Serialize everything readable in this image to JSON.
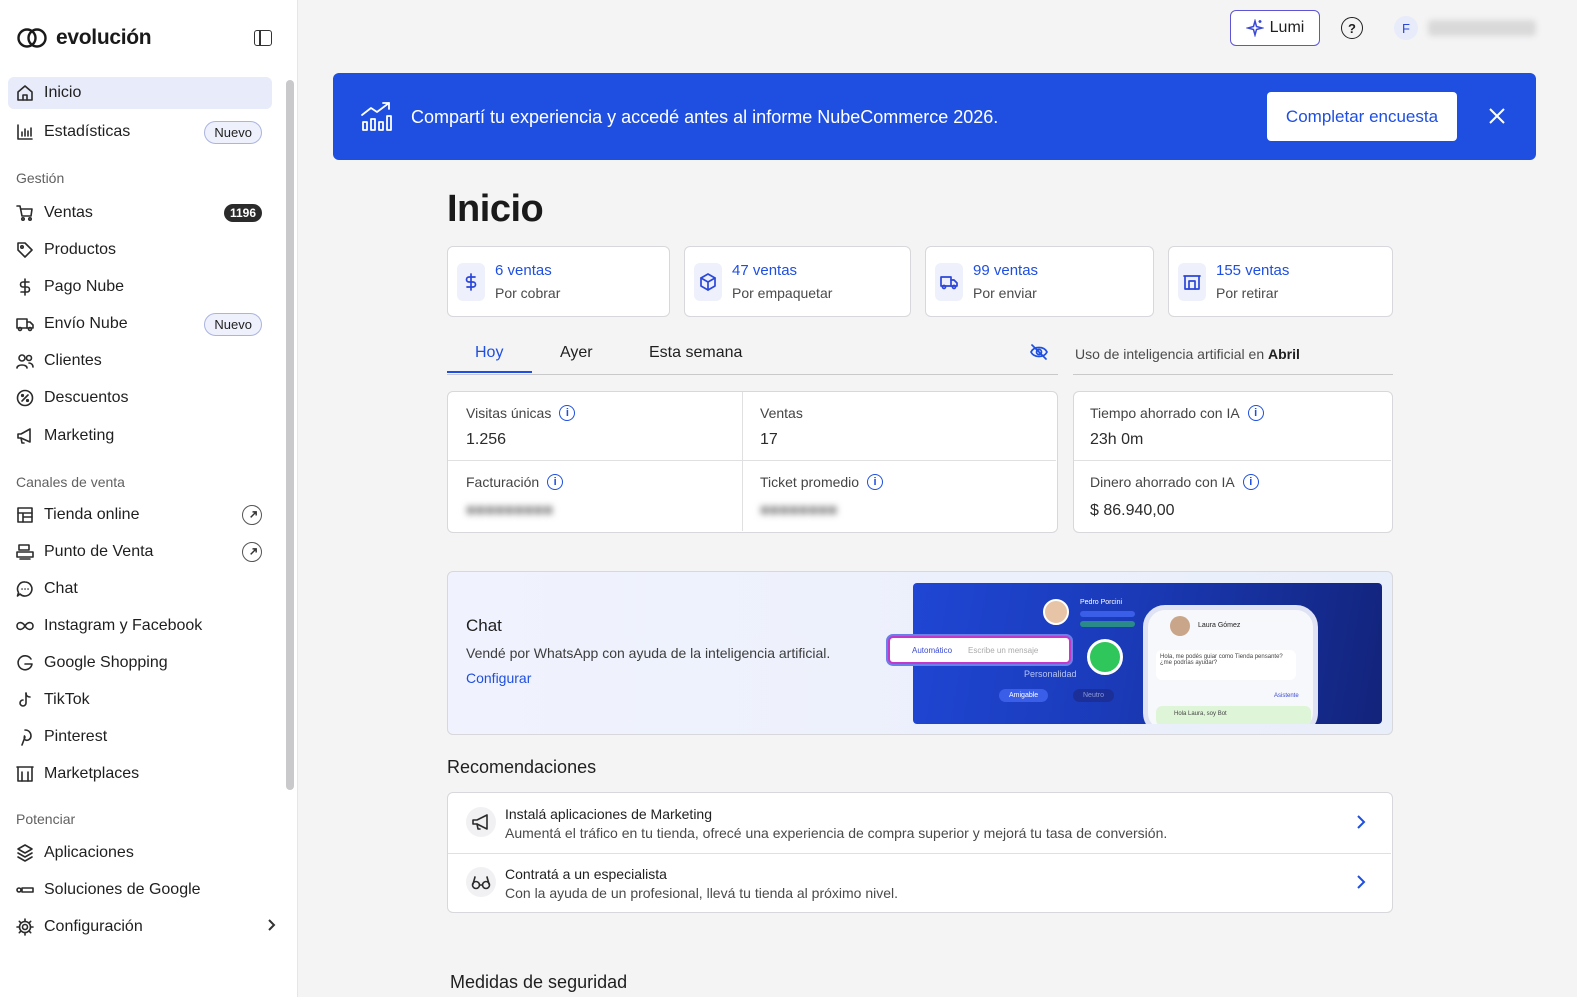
{
  "brand": {
    "name": "evolución"
  },
  "topbar": {
    "lumi_label": "Lumi",
    "avatar_initial": "F"
  },
  "sidebar": {
    "items": [
      {
        "label": "Inicio",
        "icon": "home-icon"
      },
      {
        "label": "Estadísticas",
        "icon": "chart-icon",
        "badge": "Nuevo"
      },
      {
        "label": "Ventas",
        "icon": "cart-icon",
        "count": "1196"
      },
      {
        "label": "Productos",
        "icon": "tag-icon"
      },
      {
        "label": "Pago Nube",
        "icon": "dollar-icon"
      },
      {
        "label": "Envío Nube",
        "icon": "truck-icon",
        "badge": "Nuevo"
      },
      {
        "label": "Clientes",
        "icon": "users-icon"
      },
      {
        "label": "Descuentos",
        "icon": "percent-icon"
      },
      {
        "label": "Marketing",
        "icon": "megaphone-icon"
      },
      {
        "label": "Tienda online",
        "icon": "store-icon"
      },
      {
        "label": "Punto de Venta",
        "icon": "pos-icon"
      },
      {
        "label": "Chat",
        "icon": "chat-icon"
      },
      {
        "label": "Instagram y Facebook",
        "icon": "infinity-icon"
      },
      {
        "label": "Google Shopping",
        "icon": "google-icon"
      },
      {
        "label": "TikTok",
        "icon": "tiktok-icon"
      },
      {
        "label": "Pinterest",
        "icon": "pinterest-icon"
      },
      {
        "label": "Marketplaces",
        "icon": "marketplace-icon"
      },
      {
        "label": "Aplicaciones",
        "icon": "apps-icon"
      },
      {
        "label": "Soluciones de Google",
        "icon": "google-solutions-icon"
      },
      {
        "label": "Configuración",
        "icon": "gear-icon"
      }
    ],
    "sections": [
      "Gestión",
      "Canales de venta",
      "Potenciar"
    ]
  },
  "banner": {
    "text": "Compartí tu experiencia y accedé antes al informe NubeCommerce 2026.",
    "button": "Completar encuesta"
  },
  "page": {
    "title": "Inicio"
  },
  "stats": [
    {
      "value": "6 ventas",
      "label": "Por cobrar"
    },
    {
      "value": "47 ventas",
      "label": "Por empaquetar"
    },
    {
      "value": "99 ventas",
      "label": "Por enviar"
    },
    {
      "value": "155 ventas",
      "label": "Por retirar"
    }
  ],
  "tabs": [
    "Hoy",
    "Ayer",
    "Esta semana"
  ],
  "ai_header": {
    "prefix": "Uso de inteligencia artificial en",
    "month": "Abril"
  },
  "metrics": {
    "visits_label": "Visitas únicas",
    "visits_value": "1.256",
    "sales_label": "Ventas",
    "sales_value": "17",
    "billing_label": "Facturación",
    "ticket_label": "Ticket promedio"
  },
  "ai_metrics": {
    "time_label": "Tiempo ahorrado con IA",
    "time_value": "23h 0m",
    "money_label": "Dinero ahorrado con IA",
    "money_value": "$ 86.940,00"
  },
  "chat_card": {
    "title": "Chat",
    "description": "Vendé por WhatsApp con ayuda de la inteligencia artificial.",
    "link": "Configurar",
    "img_pill": "Automático",
    "img_placeholder": "Escribe un mensaje",
    "img_agent": "Pedro Porcini",
    "img_contact": "Laura Gómez",
    "img_personality": "Personalidad",
    "img_chip1": "Amigable",
    "img_chip2": "Neutro",
    "img_msg1": "Hola, me podés guiar como Tienda pensante? ¿me podrías ayudar?",
    "img_msg2": "Hola Laura, soy Bot",
    "img_assistant": "Asistente"
  },
  "recommendations": {
    "title": "Recomendaciones",
    "items": [
      {
        "title": "Instalá aplicaciones de Marketing",
        "subtitle": "Aumentá el tráfico en tu tienda, ofrecé una experiencia de compra superior y mejorá tu tasa de conversión."
      },
      {
        "title": "Contratá a un especialista",
        "subtitle": "Con la ayuda de un profesional, llevá tu tienda al próximo nivel."
      }
    ]
  },
  "security": {
    "title": "Medidas de seguridad"
  },
  "colors": {
    "accent": "#1f4fe0",
    "banner": "#1f4fe0",
    "active_bg": "#e7ebfa"
  }
}
